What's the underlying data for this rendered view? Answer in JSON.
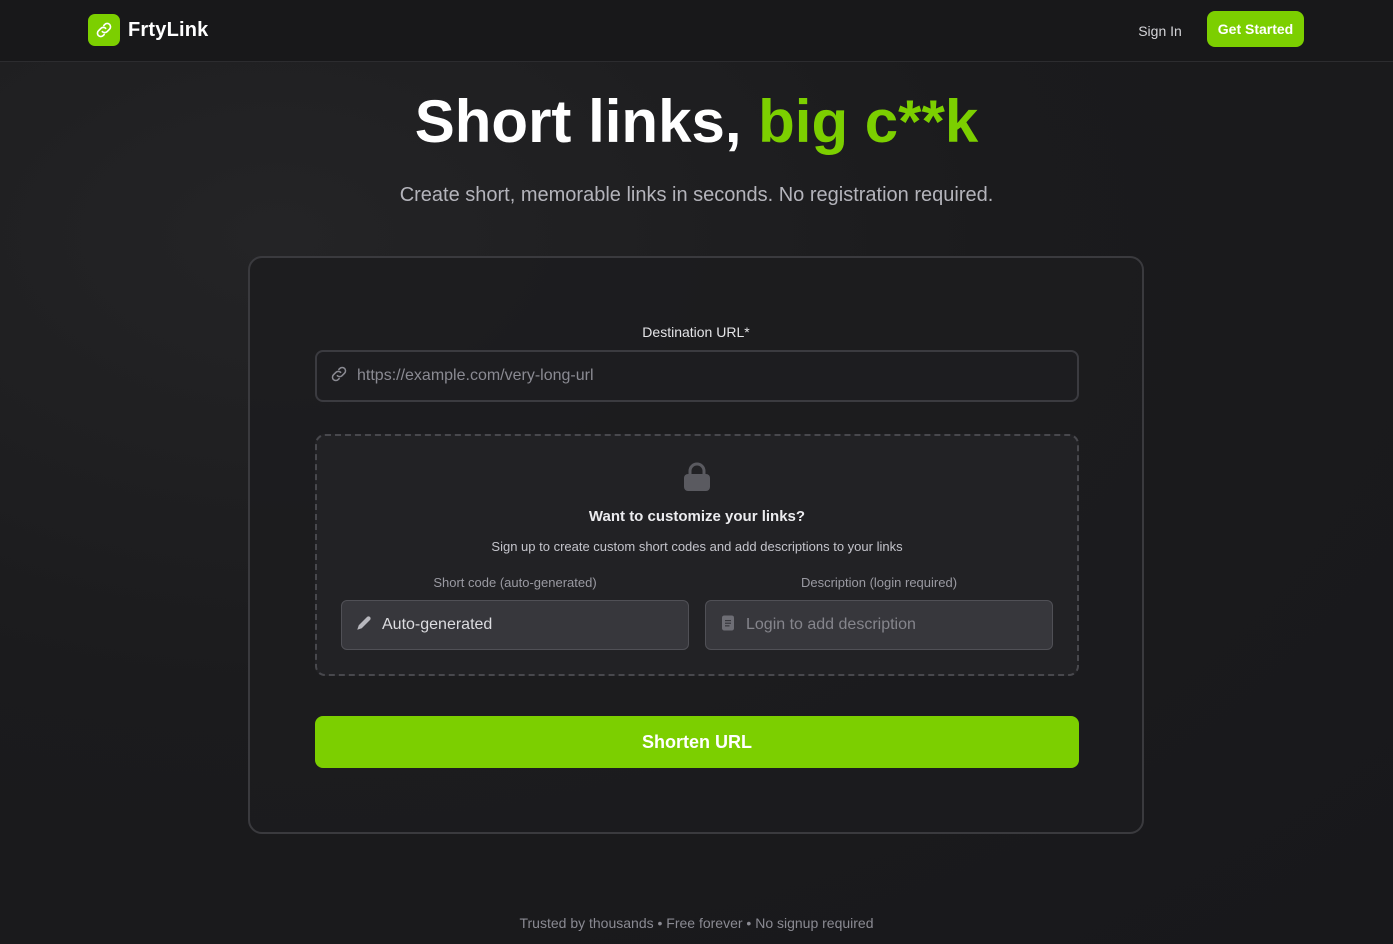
{
  "header": {
    "brand_name": "FrtyLink",
    "brand_icon": "link-icon",
    "sign_in_label": "Sign In",
    "get_started_label": "Get Started"
  },
  "hero": {
    "title_main": "Short links, ",
    "title_accent": "big c**k",
    "subtitle": "Create short, memorable links in seconds. No registration required."
  },
  "form": {
    "destination_label": "Destination URL*",
    "destination_placeholder": "https://example.com/very-long-url",
    "destination_icon": "link-icon",
    "customize": {
      "icon": "lock-icon",
      "title": "Want to customize your links?",
      "subtitle": "Sign up to create custom short codes and add descriptions to your links",
      "short_code_label": "Short code (auto-generated)",
      "short_code_value": "Auto-generated",
      "short_code_icon": "pencil-icon",
      "description_label": "Description (login required)",
      "description_placeholder": "Login to add description",
      "description_icon": "document-icon"
    },
    "submit_label": "Shorten URL"
  },
  "footer": {
    "note": "Trusted by thousands • Free forever • No signup required"
  },
  "colors": {
    "accent": "#7ccf00",
    "background": "#18181b"
  }
}
